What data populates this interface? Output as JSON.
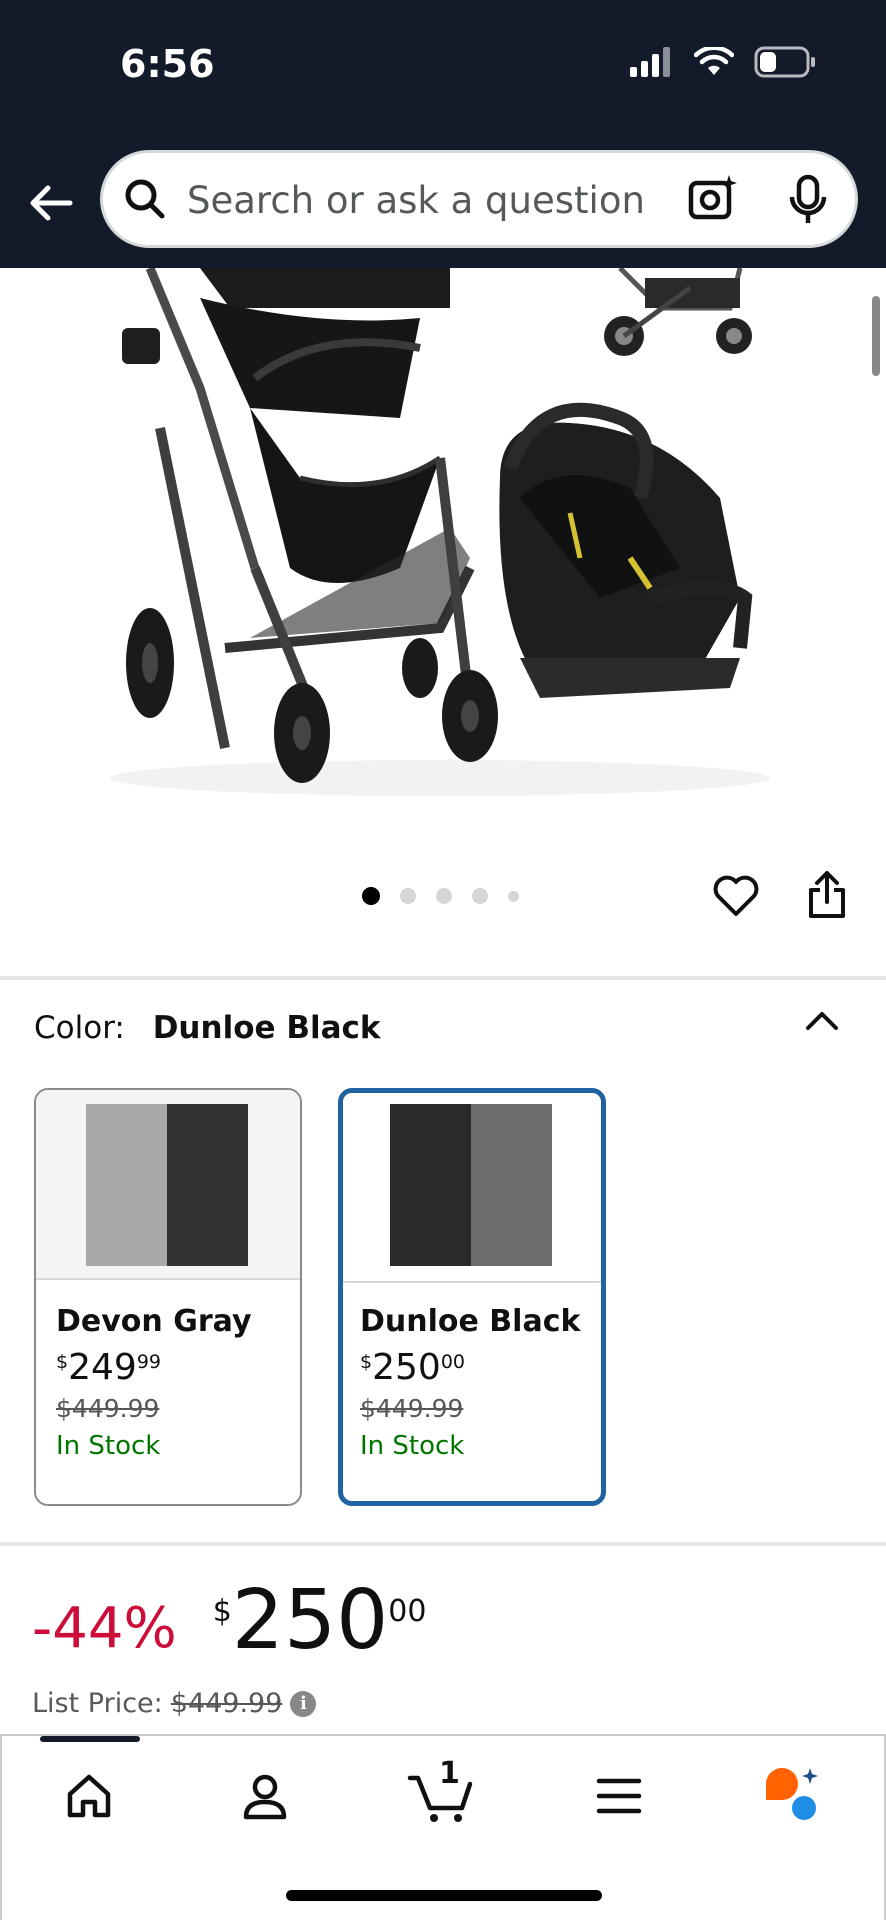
{
  "status_bar": {
    "time": "6:56"
  },
  "search": {
    "placeholder": "Search or ask a question"
  },
  "carousel": {
    "total_dots": 5,
    "active_index": 0
  },
  "color_selector": {
    "label": "Color:",
    "selected_value": "Dunloe Black",
    "options": [
      {
        "name": "Devon Gray",
        "price_symbol": "$",
        "price_whole": "249",
        "price_cents": "99",
        "list_price": "$449.99",
        "stock": "In Stock",
        "selected": false,
        "swatch_colors": [
          "#a9a9a9",
          "#323235"
        ]
      },
      {
        "name": "Dunloe Black",
        "price_symbol": "$",
        "price_whole": "250",
        "price_cents": "00",
        "list_price": "$449.99",
        "stock": "In Stock",
        "selected": true,
        "swatch_colors": [
          "#2a2a2c",
          "#6d6d6d"
        ]
      }
    ]
  },
  "price": {
    "discount": "-44%",
    "symbol": "$",
    "whole": "250",
    "cents": "00",
    "list_label": "List Price:",
    "list_value": "$449.99"
  },
  "bottom_nav": {
    "cart_count": "1"
  },
  "colors": {
    "header_bg": "#131a29",
    "selected_border": "#2162a1",
    "discount_red": "#cc0c39",
    "stock_green": "#007600",
    "rufus_orange": "#ff6200",
    "rufus_blue": "#1f8ce6"
  }
}
